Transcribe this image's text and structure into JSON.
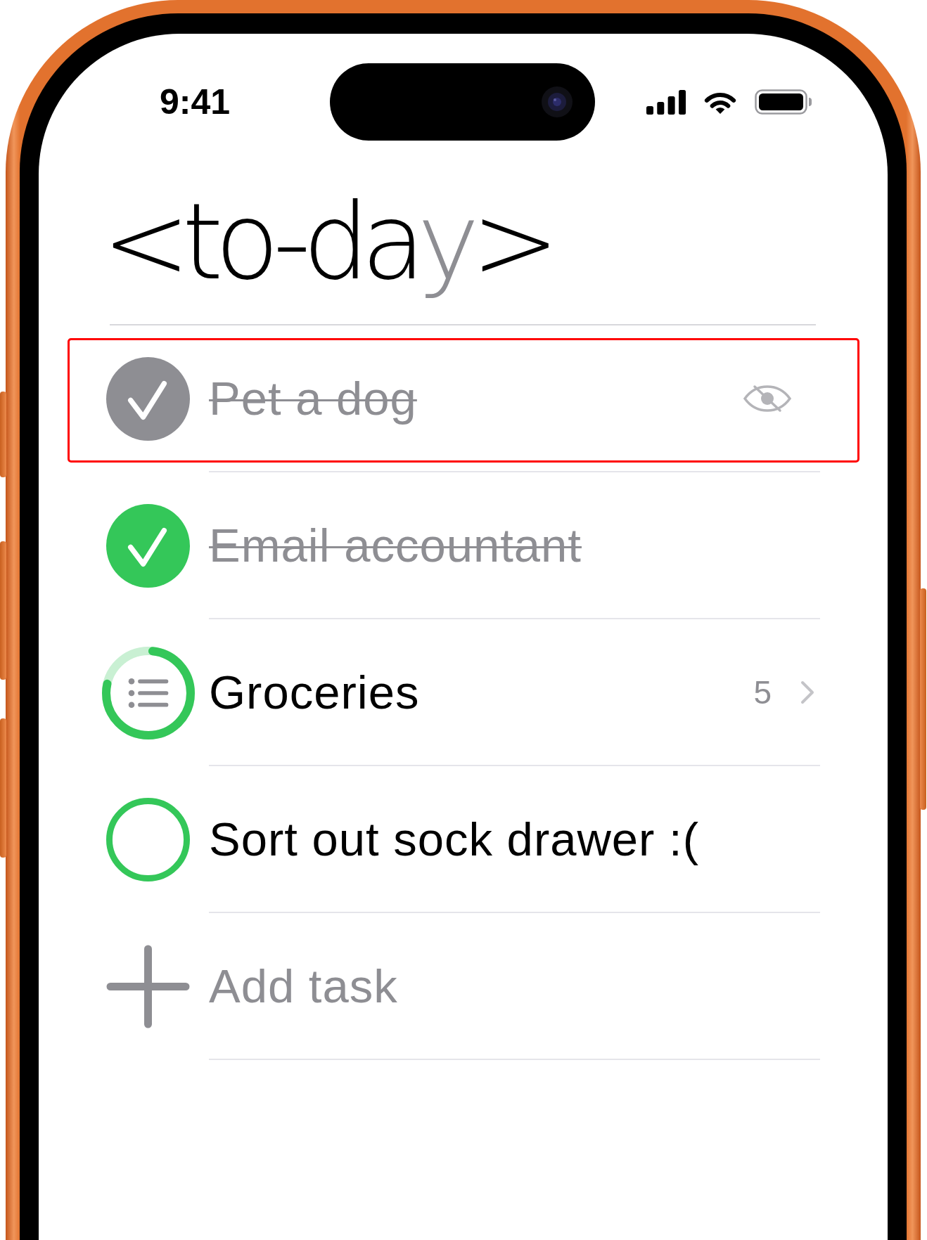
{
  "status_bar": {
    "time": "9:41"
  },
  "header": {
    "title": [
      {
        "text": "<to-da",
        "muted": false
      },
      {
        "text": "y",
        "muted": true
      },
      {
        "text": ">",
        "muted": false
      }
    ]
  },
  "tasks": [
    {
      "kind": "task",
      "title": "Pet a dog",
      "done": true,
      "hidden": true,
      "highlighted": true
    },
    {
      "kind": "task",
      "title": "Email accountant",
      "done": true,
      "hidden": false,
      "highlighted": false
    },
    {
      "kind": "list",
      "title": "Groceries",
      "done": false,
      "hidden": false,
      "level": 0.8,
      "count": "5",
      "highlighted": false
    },
    {
      "kind": "task",
      "title": "Sort out sock drawer :(",
      "done": false,
      "hidden": false,
      "highlighted": false
    }
  ],
  "add_task": {
    "placeholder": "Add task"
  }
}
